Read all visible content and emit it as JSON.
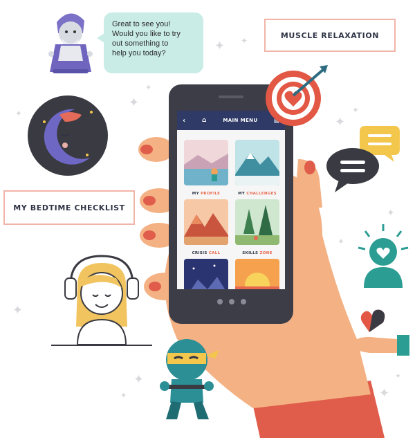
{
  "speech_bubble": {
    "line1": "Great to see you!",
    "line2": "Would you like to try",
    "line3": "out something to",
    "line4": "help you today?"
  },
  "labels": {
    "muscle_relaxation": "MUSCLE RELAXATION",
    "bedtime_checklist": "MY BEDTIME CHECKLIST"
  },
  "phone": {
    "menu_title": "MAIN MENU",
    "tiles": [
      {
        "word1": "MY",
        "word2": "PROFILE"
      },
      {
        "word1": "MY",
        "word2": "CHALLENGES"
      },
      {
        "word1": "CRISIS",
        "word2": "CALL"
      },
      {
        "word1": "SKILLS",
        "word2": "ZONE"
      }
    ]
  },
  "colors": {
    "accent": "#e7684e",
    "navy": "#2f3a66",
    "teal": "#2c9d93",
    "bubble": "#c9ece7",
    "label_border": "#f1b4a8",
    "skin": "#f4b183"
  },
  "icons": [
    "home-icon",
    "back-icon",
    "print-icon",
    "target-icon",
    "heart-icon",
    "chat-icon",
    "mind-heart-icon",
    "moon-icon",
    "wizard-icon",
    "ninja-icon",
    "headphones-person-icon",
    "hand-heart-icon"
  ]
}
